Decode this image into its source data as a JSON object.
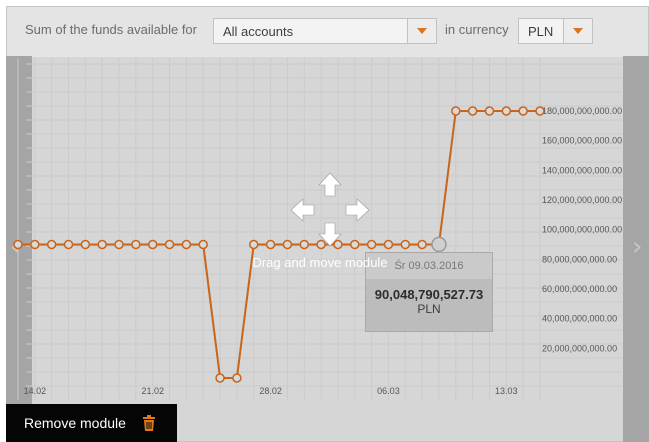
{
  "header": {
    "prefix_text": "Sum of the funds available for",
    "account_select_value": "All accounts",
    "currency_text": "in currency",
    "currency_select_value": "PLN"
  },
  "tooltip": {
    "date": "Śr 09.03.2016",
    "amount": "90,048,790,527.73",
    "currency": "PLN"
  },
  "drag_hint": "Drag and move module",
  "remove_button": "Remove module",
  "icons": {
    "prev": "chevron-left-icon",
    "next": "chevron-right-icon",
    "move": "move-arrows-icon",
    "trash": "trash-icon"
  },
  "colors": {
    "series": "#c8641c",
    "accent": "#d8751d"
  },
  "chart_data": {
    "type": "line",
    "x_tick_labels": [
      "14.02",
      "21.02",
      "28.02",
      "06.03",
      "13.03"
    ],
    "y_tick_labels": [
      "20,000,000,000.00",
      "40,000,000,000.00",
      "60,000,000,000.00",
      "80,000,000,000.00",
      "100,000,000,000.00",
      "120,000,000,000.00",
      "140,000,000,000.00",
      "160,000,000,000.00",
      "180,000,000,000.00"
    ],
    "ylim": [
      0,
      180000000000
    ],
    "x": [
      "13.02",
      "14.02",
      "15.02",
      "16.02",
      "17.02",
      "18.02",
      "19.02",
      "20.02",
      "21.02",
      "22.02",
      "23.02",
      "24.02",
      "25.02",
      "26.02",
      "27.02",
      "28.02",
      "29.02",
      "01.03",
      "02.03",
      "03.03",
      "04.03",
      "05.03",
      "06.03",
      "07.03",
      "08.03",
      "09.03",
      "10.03",
      "11.03",
      "12.03",
      "13.03",
      "14.03",
      "15.03"
    ],
    "values": [
      90000000000,
      90000000000,
      90000000000,
      90000000000,
      90000000000,
      90000000000,
      90000000000,
      90000000000,
      90000000000,
      90000000000,
      90000000000,
      90000000000,
      0,
      0,
      90000000000,
      90000000000,
      90000000000,
      90000000000,
      90000000000,
      90000000000,
      90000000000,
      90000000000,
      90000000000,
      90000000000,
      90000000000,
      90048790527.73,
      180000000000,
      180000000000,
      180000000000,
      180000000000,
      180000000000,
      180000000000
    ],
    "highlight_index": 25
  }
}
